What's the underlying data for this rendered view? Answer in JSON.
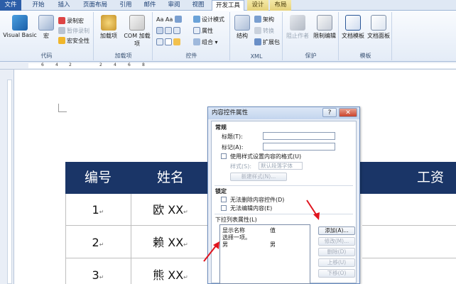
{
  "tabs": [
    "文件",
    "开始",
    "插入",
    "页面布局",
    "引用",
    "邮件",
    "审阅",
    "视图",
    "开发工具",
    "设计",
    "布局"
  ],
  "ribbon": {
    "code": {
      "title": "代码",
      "visual_basic": "Visual Basic",
      "macro": "宏",
      "record_macro": "录制宏",
      "pause_recording": "暂停录制",
      "macro_security": "宏安全性"
    },
    "addins": {
      "title": "加载项",
      "addins": "加载项",
      "com_addins": "COM 加载项"
    },
    "controls": {
      "title": "控件",
      "design_mode": "设计模式",
      "properties": "属性",
      "group": "组合"
    },
    "xml": {
      "title": "XML",
      "structure": "结构",
      "schema": "架构",
      "transform": "转换",
      "expansion_pack": "扩展包"
    },
    "protect": {
      "title": "保护",
      "block_authors": "阻止作者",
      "restrict_editing": "限制编辑"
    },
    "templates": {
      "title": "模板",
      "document_template": "文档模板",
      "document_panel": "文档面板"
    }
  },
  "ruler": [
    "6",
    "4",
    "2",
    "2",
    "4",
    "6",
    "8"
  ],
  "table": {
    "headers": [
      "编号",
      "姓名",
      "工资"
    ],
    "rows": [
      {
        "num": "1",
        "name": "欧 XX"
      },
      {
        "num": "2",
        "name": "赖 XX"
      },
      {
        "num": "3",
        "name": "熊 XX"
      }
    ],
    "para_mark": "↵"
  },
  "dialog": {
    "title": "内容控件属性",
    "help": "?",
    "close": "✕",
    "general_section": "常规",
    "title_label": "标题(T):",
    "tag_label": "标记(A):",
    "use_style": "使用样式设置内容的格式(U)",
    "style_label": "样式(S):",
    "style_value": "默认段落字体",
    "new_style": "新建样式(N)...",
    "lock_section": "锁定",
    "lock_delete": "无法删除内容控件(D)",
    "lock_edit": "无法编辑内容(E)",
    "dropdown_section": "下拉列表属性(L)",
    "col_display": "显示名称",
    "col_value": "值",
    "items": [
      {
        "display": "选择一项。",
        "value": ""
      },
      {
        "display": "男",
        "value": "男"
      }
    ],
    "buttons": {
      "add": "添加(A)...",
      "modify": "修改(M)...",
      "delete": "删除(D)",
      "move_up": "上移(U)",
      "move_down": "下移(O)"
    }
  },
  "colors": {
    "table_header": "#1a3567",
    "arrow": "#e0141e",
    "file_tab": "#2c5ea8"
  }
}
